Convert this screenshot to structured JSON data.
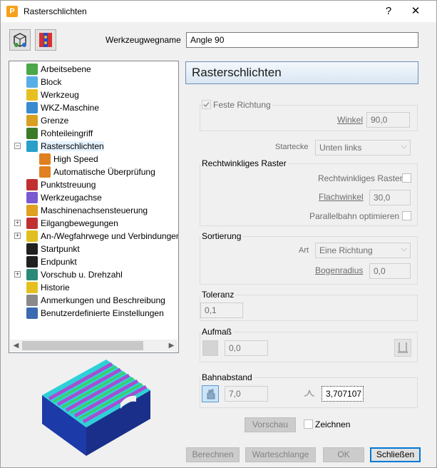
{
  "window": {
    "title": "Rasterschlichten",
    "app_icon": "P",
    "help_label": "?",
    "close_label": "✕"
  },
  "toolbar": {
    "tool_icon_1": "cube-workflow-icon",
    "tool_icon_2": "color-pattern-icon"
  },
  "toolname": {
    "label": "Werkzeugwegname",
    "value": "Angle 90"
  },
  "tree": {
    "items": [
      {
        "label": "Arbeitsebene",
        "icon": "workplane-icon",
        "color": "#4aa84a"
      },
      {
        "label": "Block",
        "icon": "block-icon",
        "color": "#5aaee8"
      },
      {
        "label": "Werkzeug",
        "icon": "tool-icon",
        "color": "#e6c020"
      },
      {
        "label": "WKZ-Maschine",
        "icon": "machine-icon",
        "color": "#3a8bd0"
      },
      {
        "label": "Grenze",
        "icon": "boundary-icon",
        "color": "#d8a020"
      },
      {
        "label": "Rohteileingriff",
        "icon": "stock-engagement-icon",
        "color": "#3c7a2a"
      },
      {
        "label": "Rasterschlichten",
        "icon": "raster-finishing-icon",
        "color": "#2aa0c8"
      },
      {
        "label": "High Speed",
        "icon": "high-speed-icon",
        "color": "#e08020"
      },
      {
        "label": "Automatische Überprüfung",
        "icon": "auto-check-icon",
        "color": "#e08020"
      },
      {
        "label": "Punktstreuung",
        "icon": "point-distribution-icon",
        "color": "#c03030"
      },
      {
        "label": "Werkzeugachse",
        "icon": "tool-axis-icon",
        "color": "#7a5ad0"
      },
      {
        "label": "Maschinenachsensteuerung",
        "icon": "machine-axis-control-icon",
        "color": "#e0a020"
      },
      {
        "label": "Eilgangbewegungen",
        "icon": "rapid-moves-icon",
        "color": "#c03030"
      },
      {
        "label": "An-/Wegfahrwege und Verbindungen",
        "icon": "leads-links-icon",
        "color": "#e0c020"
      },
      {
        "label": "Startpunkt",
        "icon": "start-point-icon",
        "color": "#202020"
      },
      {
        "label": "Endpunkt",
        "icon": "end-point-icon",
        "color": "#202020"
      },
      {
        "label": "Vorschub u. Drehzahl",
        "icon": "feeds-speeds-icon",
        "color": "#2a8a7a"
      },
      {
        "label": "Historie",
        "icon": "history-icon",
        "color": "#e6c020"
      },
      {
        "label": "Anmerkungen und Beschreibung",
        "icon": "notes-icon",
        "color": "#8a8a8a"
      },
      {
        "label": "Benutzerdefinierte Einstellungen",
        "icon": "user-settings-icon",
        "color": "#3a6ab0"
      }
    ]
  },
  "panel": {
    "header": "Rasterschlichten",
    "fixed_direction": {
      "label": "Feste Richtung",
      "checked": true
    },
    "angle": {
      "label": "Winkel",
      "value": "90,0"
    },
    "start_corner": {
      "label": "Startecke",
      "value": "Unten links"
    },
    "orthogonal": {
      "title": "Rechtwinkliges Raster",
      "checkbox_label": "Rechtwinkliges Raster",
      "flat_angle_label": "Flachwinkel",
      "flat_angle_value": "30,0",
      "parallel_label": "Parallelbahn optimieren"
    },
    "ordering": {
      "title": "Sortierung",
      "type_label": "Art",
      "type_value": "Eine Richtung",
      "arc_radius_label": "Bogenradius",
      "arc_radius_value": "0,0"
    },
    "tolerance": {
      "title": "Toleranz",
      "value": "0,1"
    },
    "allowance": {
      "title": "Aufmaß",
      "value": "0,0"
    },
    "stepover": {
      "title": "Bahnabstand",
      "value": "7,0",
      "cusp_value": "3,707107"
    },
    "preview": {
      "button_label": "Vorschau",
      "draw_label": "Zeichnen"
    }
  },
  "footer": {
    "calculate": "Berechnen",
    "queue": "Warteschlange",
    "ok": "OK",
    "close": "Schließen"
  }
}
